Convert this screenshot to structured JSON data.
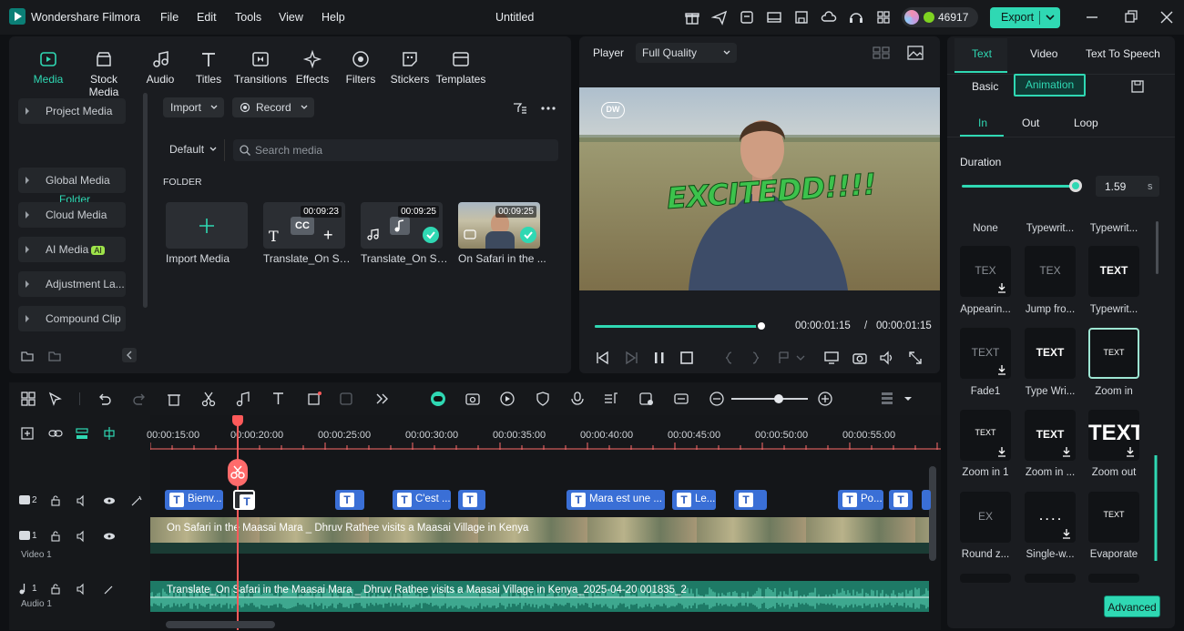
{
  "titlebar": {
    "app_name": "Wondershare Filmora",
    "menu": [
      "File",
      "Edit",
      "Tools",
      "View",
      "Help"
    ],
    "doc_title": "Untitled",
    "credits": "46917",
    "export_label": "Export"
  },
  "media": {
    "tabs": [
      "Media",
      "Stock Media",
      "Audio",
      "Titles",
      "Transitions",
      "Effects",
      "Filters",
      "Stickers",
      "Templates"
    ],
    "sidebar": [
      "Project Media",
      "Global Media",
      "Cloud Media",
      "AI Media",
      "Adjustment La...",
      "Compound Clip"
    ],
    "ai_badge": "AI",
    "folder": "Folder",
    "import_btn": "Import",
    "record_btn": "Record",
    "sort": "Default",
    "search_placeholder": "Search media",
    "folder_heading": "FOLDER",
    "import_media": "Import Media",
    "items": [
      {
        "name": "Translate_On Saf...",
        "duration": "00:09:23"
      },
      {
        "name": "Translate_On Saf...",
        "duration": "00:09:25"
      },
      {
        "name": "On Safari in the ...",
        "duration": "00:09:25"
      }
    ]
  },
  "player": {
    "label": "Player",
    "quality": "Full Quality",
    "overlay_text": "EXCITEDD!!!!",
    "logo": "DW",
    "current_time": "00:00:01:15",
    "separator": "/",
    "total_time": "00:00:01:15",
    "progress": 1.0
  },
  "right": {
    "tabs": [
      "Text",
      "Video",
      "Text To Speech"
    ],
    "basic": "Basic",
    "animation": "Animation",
    "subtabs": [
      "In",
      "Out",
      "Loop"
    ],
    "duration_label": "Duration",
    "duration_value": "1.59",
    "duration_unit": "s",
    "duration_fraction": 0.95,
    "presets": [
      "None",
      "Typewrit...",
      "Typewrit...",
      "Appearin...",
      "Jump fro...",
      "Typewrit...",
      "Fade1",
      "Type Wri...",
      "Zoom in",
      "Zoom in 1",
      "Zoom in ...",
      "Zoom out",
      "Round z...",
      "Single-w...",
      "Evaporate"
    ],
    "card_texts": [
      "TEX",
      "TEX",
      "TEXT",
      "TEXT",
      "TEXT",
      "TEXT",
      "TEXT",
      "TEXT",
      "TEXT",
      "EX",
      ". . . .",
      "TEXT"
    ],
    "advanced": "Advanced"
  },
  "timeline": {
    "ruler": [
      "00:00:15:00",
      "00:00:20:00",
      "00:00:25:00",
      "00:00:30:00",
      "00:00:35:00",
      "00:00:40:00",
      "00:00:45:00",
      "00:00:50:00",
      "00:00:55:00"
    ],
    "text_clips": [
      "Bienv...",
      "",
      "",
      "C'est ...",
      "",
      "Mara est une ...",
      "Le...",
      "",
      "Po...",
      ""
    ],
    "video_track_label": "Video 1",
    "audio_track_label": "Audio 1",
    "track_numbers": [
      "2",
      "1",
      "1"
    ],
    "video_clip": "On Safari in the Maasai Mara _ Dhruv Rathee visits a Maasai Village in Kenya",
    "audio_clip": "Translate_On Safari in the Maasai Mara _ Dhruv Rathee visits a Maasai Village in Kenya_2025-04-20 001835_2"
  },
  "colors": {
    "accent": "#2fd8b3",
    "playhead": "#ff5a5a",
    "text_clip": "#3a6fd6",
    "audio": "#1e7a66"
  }
}
